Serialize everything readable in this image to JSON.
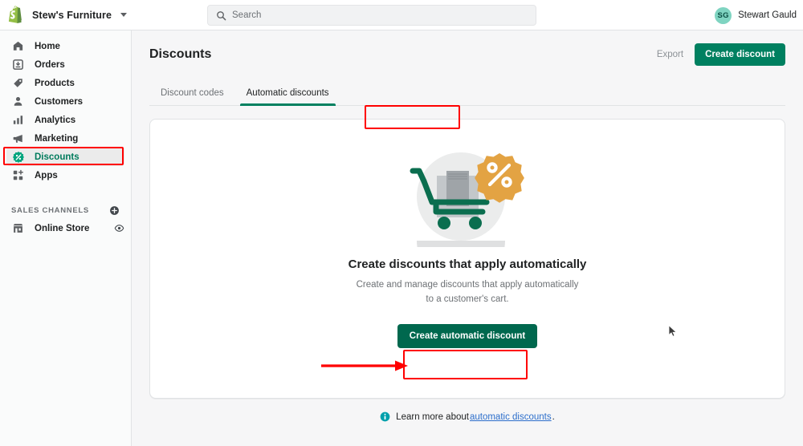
{
  "topbar": {
    "logo_icon": "shopify-logo",
    "store_name": "Stew's Furniture",
    "store_switcher_icon": "chevron-down-icon",
    "search": {
      "icon": "search-icon",
      "placeholder": "Search",
      "value": ""
    },
    "account": {
      "initials": "SG",
      "name": "Stewart Gauld"
    }
  },
  "sidebar": {
    "items": [
      {
        "label": "Home",
        "icon": "home-icon",
        "active": false
      },
      {
        "label": "Orders",
        "icon": "orders-icon",
        "active": false
      },
      {
        "label": "Products",
        "icon": "tag-icon",
        "active": false
      },
      {
        "label": "Customers",
        "icon": "person-icon",
        "active": false
      },
      {
        "label": "Analytics",
        "icon": "bar-chart-icon",
        "active": false
      },
      {
        "label": "Marketing",
        "icon": "megaphone-icon",
        "active": false
      },
      {
        "label": "Discounts",
        "icon": "discount-icon",
        "active": true
      },
      {
        "label": "Apps",
        "icon": "apps-icon",
        "active": false
      }
    ],
    "sales_channels": {
      "title": "SALES CHANNELS",
      "add_icon": "plus-circle-icon",
      "items": [
        {
          "label": "Online Store",
          "icon": "storefront-icon",
          "trailing_icon": "eye-icon"
        }
      ]
    }
  },
  "main": {
    "page_title": "Discounts",
    "export_label": "Export",
    "create_discount_label": "Create discount",
    "tabs": [
      {
        "label": "Discount codes",
        "active": false
      },
      {
        "label": "Automatic discounts",
        "active": true
      }
    ],
    "empty_state": {
      "illustration": "shopping-cart-with-percent-badge",
      "title": "Create discounts that apply automatically",
      "subtitle": "Create and manage discounts that apply automatically to a customer's cart.",
      "cta_label": "Create automatic discount"
    },
    "footer": {
      "icon": "info-icon",
      "text": "Learn more about ",
      "link_text": "automatic discounts",
      "period": "."
    }
  },
  "annotations": {
    "highlight_color": "#ff0000",
    "boxes": [
      "discounts-nav-item",
      "automatic-discounts-tab",
      "create-automatic-discount-button"
    ],
    "arrow": "arrow-pointing-to-create-automatic-discount-button"
  },
  "colors": {
    "brand_green": "#008060",
    "cta_green": "#00684e",
    "active_nav_green": "#007b5c",
    "link_blue": "#2c6ecb",
    "avatar_teal": "#7fd4c1",
    "badge_orange": "#e3a343"
  }
}
